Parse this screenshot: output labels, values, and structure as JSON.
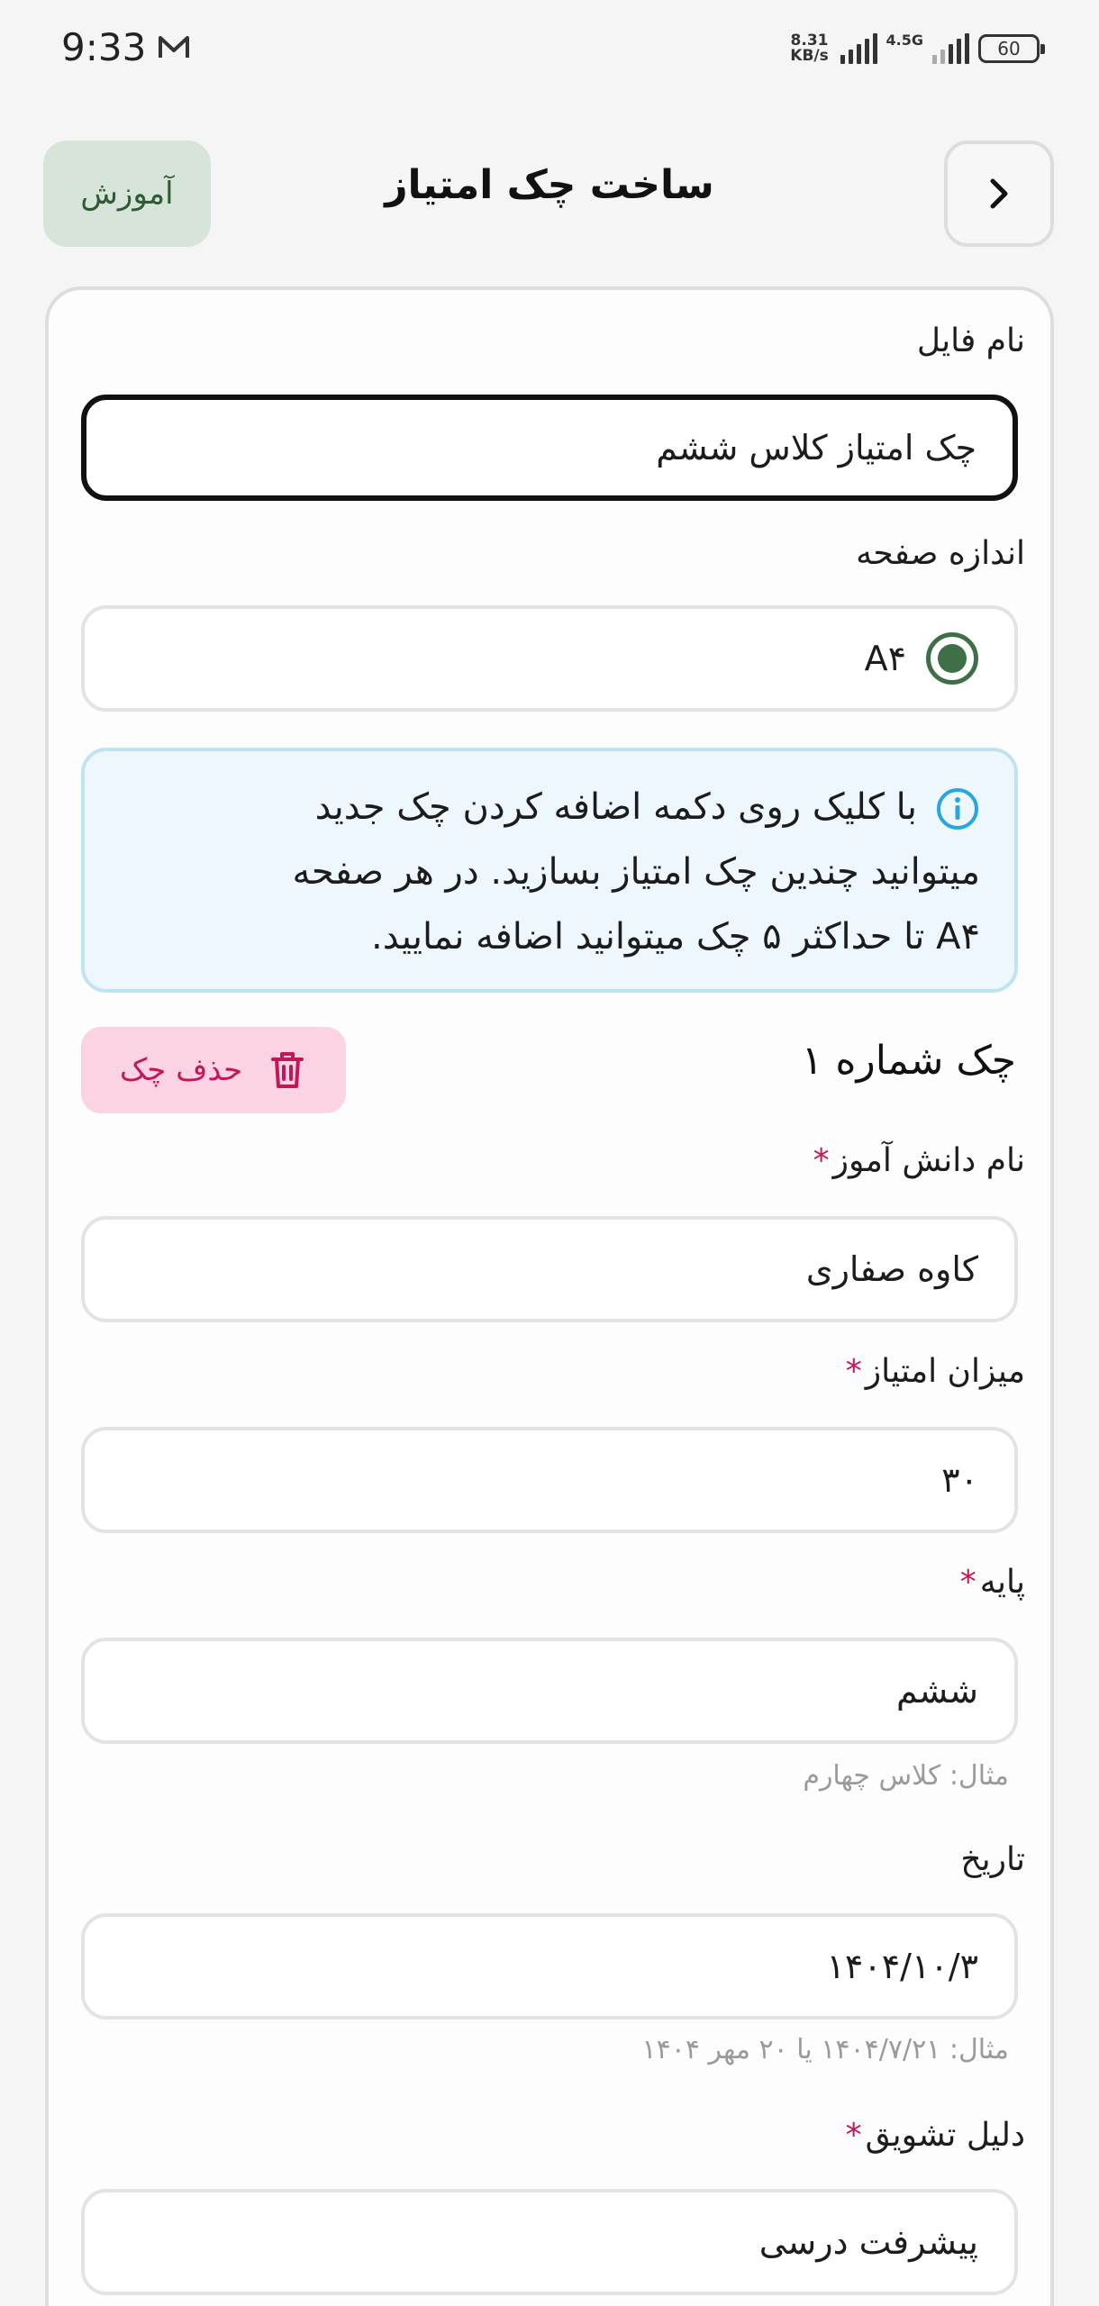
{
  "status_bar": {
    "time": "9:33",
    "net_speed_value": "8.31",
    "net_speed_unit": "KB/s",
    "network_type": "4.5G",
    "battery": "60",
    "icons": [
      "mail-icon",
      "signal-icon",
      "battery-icon"
    ]
  },
  "header": {
    "title": "ساخت چک امتیاز",
    "tutorial_label": "آموزش",
    "back_icon": "chevron-right-icon"
  },
  "form": {
    "file_name": {
      "label": "نام فایل",
      "value": "چک امتیاز کلاس ششم"
    },
    "page_size": {
      "label": "اندازه صفحه",
      "option": "A۴",
      "selected": true
    },
    "info": {
      "icon": "info-icon",
      "line1": "با کلیک روی دکمه اضافه کردن چک جدید",
      "line2": "میتوانید چندین چک امتیاز بسازید. در هر صفحه",
      "line3": "A۴ تا حداکثر ۵ چک میتوانید اضافه نمایید."
    },
    "check": {
      "title": "چک شماره ۱",
      "delete_label": "حذف چک",
      "delete_icon": "trash-icon"
    },
    "student_name": {
      "label": "نام دانش آموز",
      "required": "*",
      "value": "کاوه صفاری"
    },
    "score": {
      "label": "میزان امتیاز",
      "required": "*",
      "value": "۳۰"
    },
    "grade": {
      "label": "پایه",
      "required": "*",
      "value": "ششم",
      "helper": "مثال: کلاس چهارم"
    },
    "date": {
      "label": "تاریخ",
      "value": "۱۴۰۴/۱۰/۳",
      "helper": "مثال: ۱۴۰۴/۷/۲۱ یا ۲۰ مهر ۱۴۰۴"
    },
    "reason": {
      "label": "دلیل تشویق",
      "required": "*",
      "value": "پیشرفت درسی"
    }
  },
  "colors": {
    "accent_green": "#3f6f47",
    "tutorial_bg": "#d7e4d9",
    "delete_bg": "#fbd3e2",
    "delete_fg": "#c2185b",
    "info_bg": "#edf7fd",
    "info_border": "#bfe3f2"
  }
}
